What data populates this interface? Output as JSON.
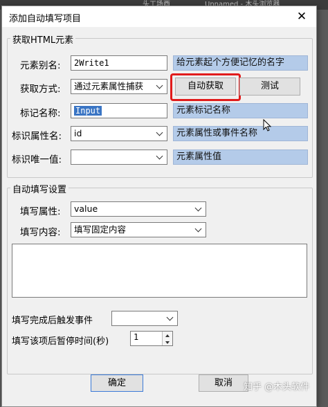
{
  "background_tabs": [
    {
      "label": "头工场酉"
    },
    {
      "label": "Unnamed - 木头浏览器"
    }
  ],
  "dialog": {
    "title": "添加自动填写项目",
    "close_symbol": "✕"
  },
  "html_group": {
    "legend": "获取HTML元素",
    "alias": {
      "label": "元素别名:",
      "value": "2Write1",
      "hint": "给元素起个方便记忆的名字"
    },
    "method": {
      "label": "获取方式:",
      "selected": "通过元素属性捕获"
    },
    "auto_button": "自动获取",
    "test_button": "测试",
    "tag": {
      "label": "标记名称:",
      "value": "Input",
      "hint": "元素标记名称"
    },
    "attr_name": {
      "label": "标识属性名:",
      "selected": "id",
      "hint": "元素属性或事件名称"
    },
    "attr_value": {
      "label": "标识唯一值:",
      "selected": "",
      "hint": "元素属性值"
    }
  },
  "fill_group": {
    "legend": "自动填写设置",
    "attribute": {
      "label": "填写属性:",
      "selected": "value"
    },
    "content": {
      "label": "填写内容:",
      "selected": "填写固定内容"
    },
    "textarea_value": "",
    "trigger": {
      "label": "填写完成后触发事件",
      "selected": ""
    },
    "pause": {
      "label": "填写该项后暂停时间(秒)",
      "value": "1"
    }
  },
  "buttons": {
    "ok": "确定",
    "cancel": "取消"
  },
  "colors": {
    "hint_bg": "#b4cbe9",
    "highlight_ring": "#e11b1b",
    "selection": "#3a75c4"
  },
  "watermark": "知乎 @木头软件"
}
